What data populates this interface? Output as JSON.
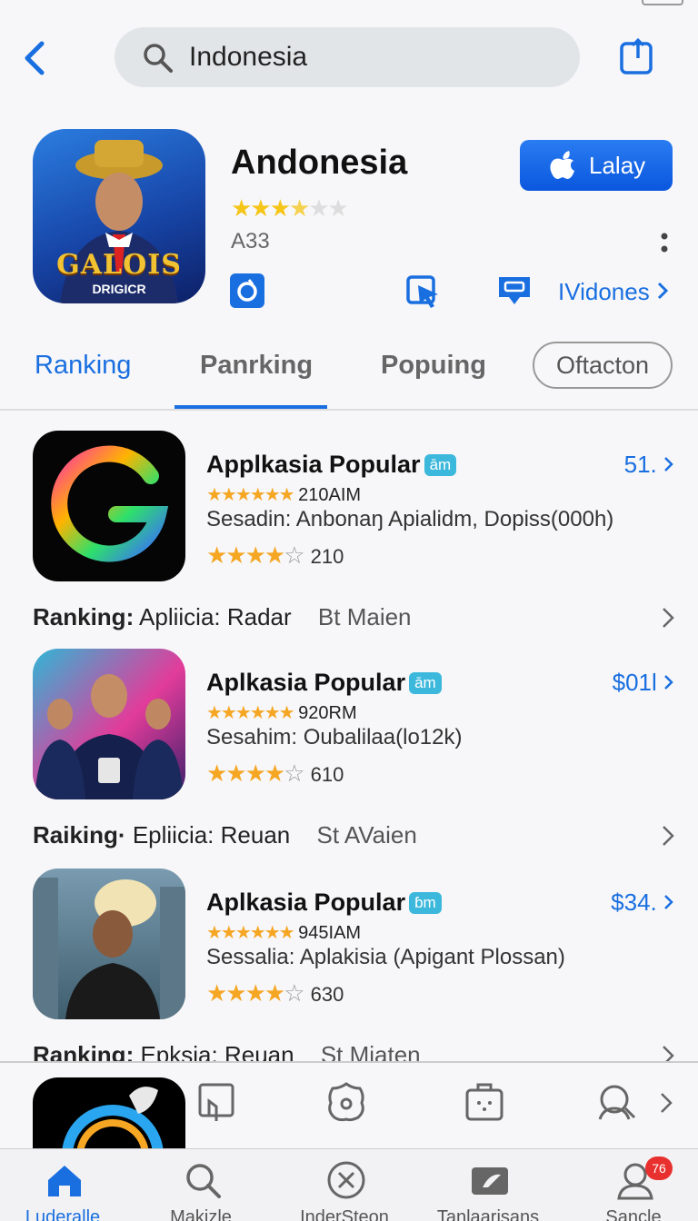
{
  "search": {
    "query": "Indonesia"
  },
  "app": {
    "name": "Andonesia",
    "rating_stars": 3.5,
    "code": "A33",
    "get_label": "Lalay",
    "icon_text": "GALOIS",
    "icon_subtext": "DRIGICR",
    "more_label": "IVidones"
  },
  "tabs": [
    {
      "label": "Ranking",
      "active": true
    },
    {
      "label": "Panrking",
      "active": false
    },
    {
      "label": "Popuing",
      "active": false
    },
    {
      "label": "Oftacton",
      "active": false
    }
  ],
  "rows": [
    {
      "title": "Applkasia Popular",
      "badge": "ām",
      "count": "210AIM",
      "desc": "Sesadin:  Anbonaŋ Apialidm, Dopiss(000h)",
      "rating_value": "210",
      "price": "51.",
      "rank_label": "Ranking:",
      "rank_text": "Apliicia: Radar",
      "rank_extra": "Bt  Maien"
    },
    {
      "title": "Aplkasia Popular",
      "badge": "ām",
      "count": "920RM",
      "desc": "Sesahim:  Oubalilaa(lo12k)",
      "rating_value": "610",
      "price": "$01l",
      "rank_label": "Raiking·",
      "rank_text": "Epliicia: Reuan",
      "rank_extra": "St  AVaien"
    },
    {
      "title": "Aplkasia Popular",
      "badge": "ɓm",
      "count": "945IAM",
      "desc": "Sessalia:  Aplakisia (Apigant Plossan)",
      "rating_value": "630",
      "price": "$34.",
      "rank_label": "Ranking:",
      "rank_text": "Epksia: Reuan",
      "rank_extra": "St  Miaten"
    }
  ],
  "tab_bar": [
    {
      "label": "Luderalle",
      "icon": "home-icon",
      "active": true
    },
    {
      "label": "Makizle",
      "icon": "search-icon",
      "active": false
    },
    {
      "label": "InderSteon",
      "icon": "close-circle-icon",
      "active": false
    },
    {
      "label": "Tanlaarisans",
      "icon": "photo-icon",
      "active": false
    },
    {
      "label": "Sancle",
      "icon": "person-icon",
      "active": false,
      "badge": "76"
    }
  ],
  "colors": {
    "accent": "#1a6fe0",
    "star": "#f5a623",
    "badge": "#3cb8dc"
  }
}
